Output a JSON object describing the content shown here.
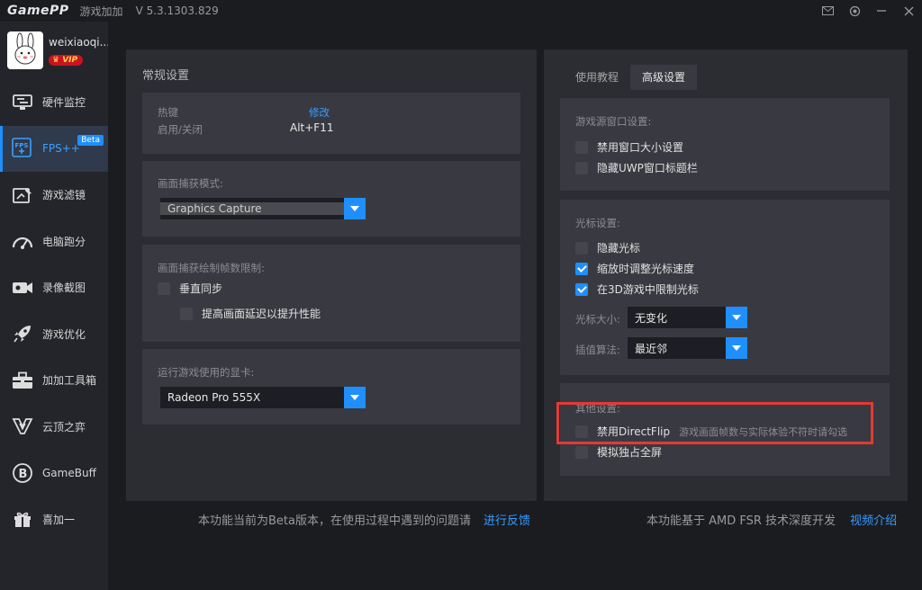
{
  "titlebar": {
    "logo": "GamePP",
    "app_name": "游戏加加",
    "version": "V 5.3.1303.829"
  },
  "user": {
    "name": "weixiaoqi...",
    "badge": "VIP"
  },
  "sidebar": {
    "items": [
      {
        "label": "硬件监控",
        "icon": "hardware-monitor-icon"
      },
      {
        "label": "FPS++",
        "icon": "fps-icon",
        "badge": "Beta",
        "active": true
      },
      {
        "label": "游戏滤镜",
        "icon": "filter-icon"
      },
      {
        "label": "电脑跑分",
        "icon": "benchmark-icon"
      },
      {
        "label": "录像截图",
        "icon": "camera-icon"
      },
      {
        "label": "游戏优化",
        "icon": "rocket-icon"
      },
      {
        "label": "加加工具箱",
        "icon": "toolbox-icon"
      },
      {
        "label": "云顶之弈",
        "icon": "tft-icon"
      },
      {
        "label": "GameBuff",
        "icon": "gamebuff-icon"
      },
      {
        "label": "喜加一",
        "icon": "gift-icon"
      }
    ]
  },
  "left": {
    "title": "常规设置",
    "hotkey": {
      "label": "热键",
      "modify": "修改",
      "toggle_label": "启用/关闭",
      "value": "Alt+F11"
    },
    "capture": {
      "label": "画面捕获模式:",
      "selected": "Graphics Capture"
    },
    "framelimit": {
      "label": "画面捕获绘制帧数限制:",
      "vsync": "垂直同步",
      "boost": "提高画面延迟以提升性能"
    },
    "gpu": {
      "label": "运行游戏使用的显卡:",
      "selected": "Radeon Pro 555X"
    }
  },
  "right": {
    "tabs": [
      "使用教程",
      "高级设置"
    ],
    "window": {
      "label": "游戏源窗口设置:",
      "opt1": "禁用窗口大小设置",
      "opt2": "隐藏UWP窗口标题栏"
    },
    "cursor": {
      "label": "光标设置:",
      "opt1": "隐藏光标",
      "opt2": "缩放时调整光标速度",
      "opt3": "在3D游戏中限制光标",
      "size_label": "光标大小:",
      "size_value": "无变化",
      "algo_label": "插值算法:",
      "algo_value": "最近邻"
    },
    "other": {
      "label": "其他设置:",
      "opt1": "禁用DirectFlip",
      "opt1_hint": "游戏画面帧数与实际体验不符时请勾选",
      "opt2": "模拟独占全屏"
    }
  },
  "footer": {
    "left_text": "本功能当前为Beta版本，在使用过程中遇到的问题请",
    "left_link": "进行反馈",
    "right_text": "本功能基于 AMD FSR 技术深度开发",
    "right_link": "视频介绍"
  },
  "colors": {
    "accent": "#1f8fff",
    "highlight": "#e53935"
  }
}
